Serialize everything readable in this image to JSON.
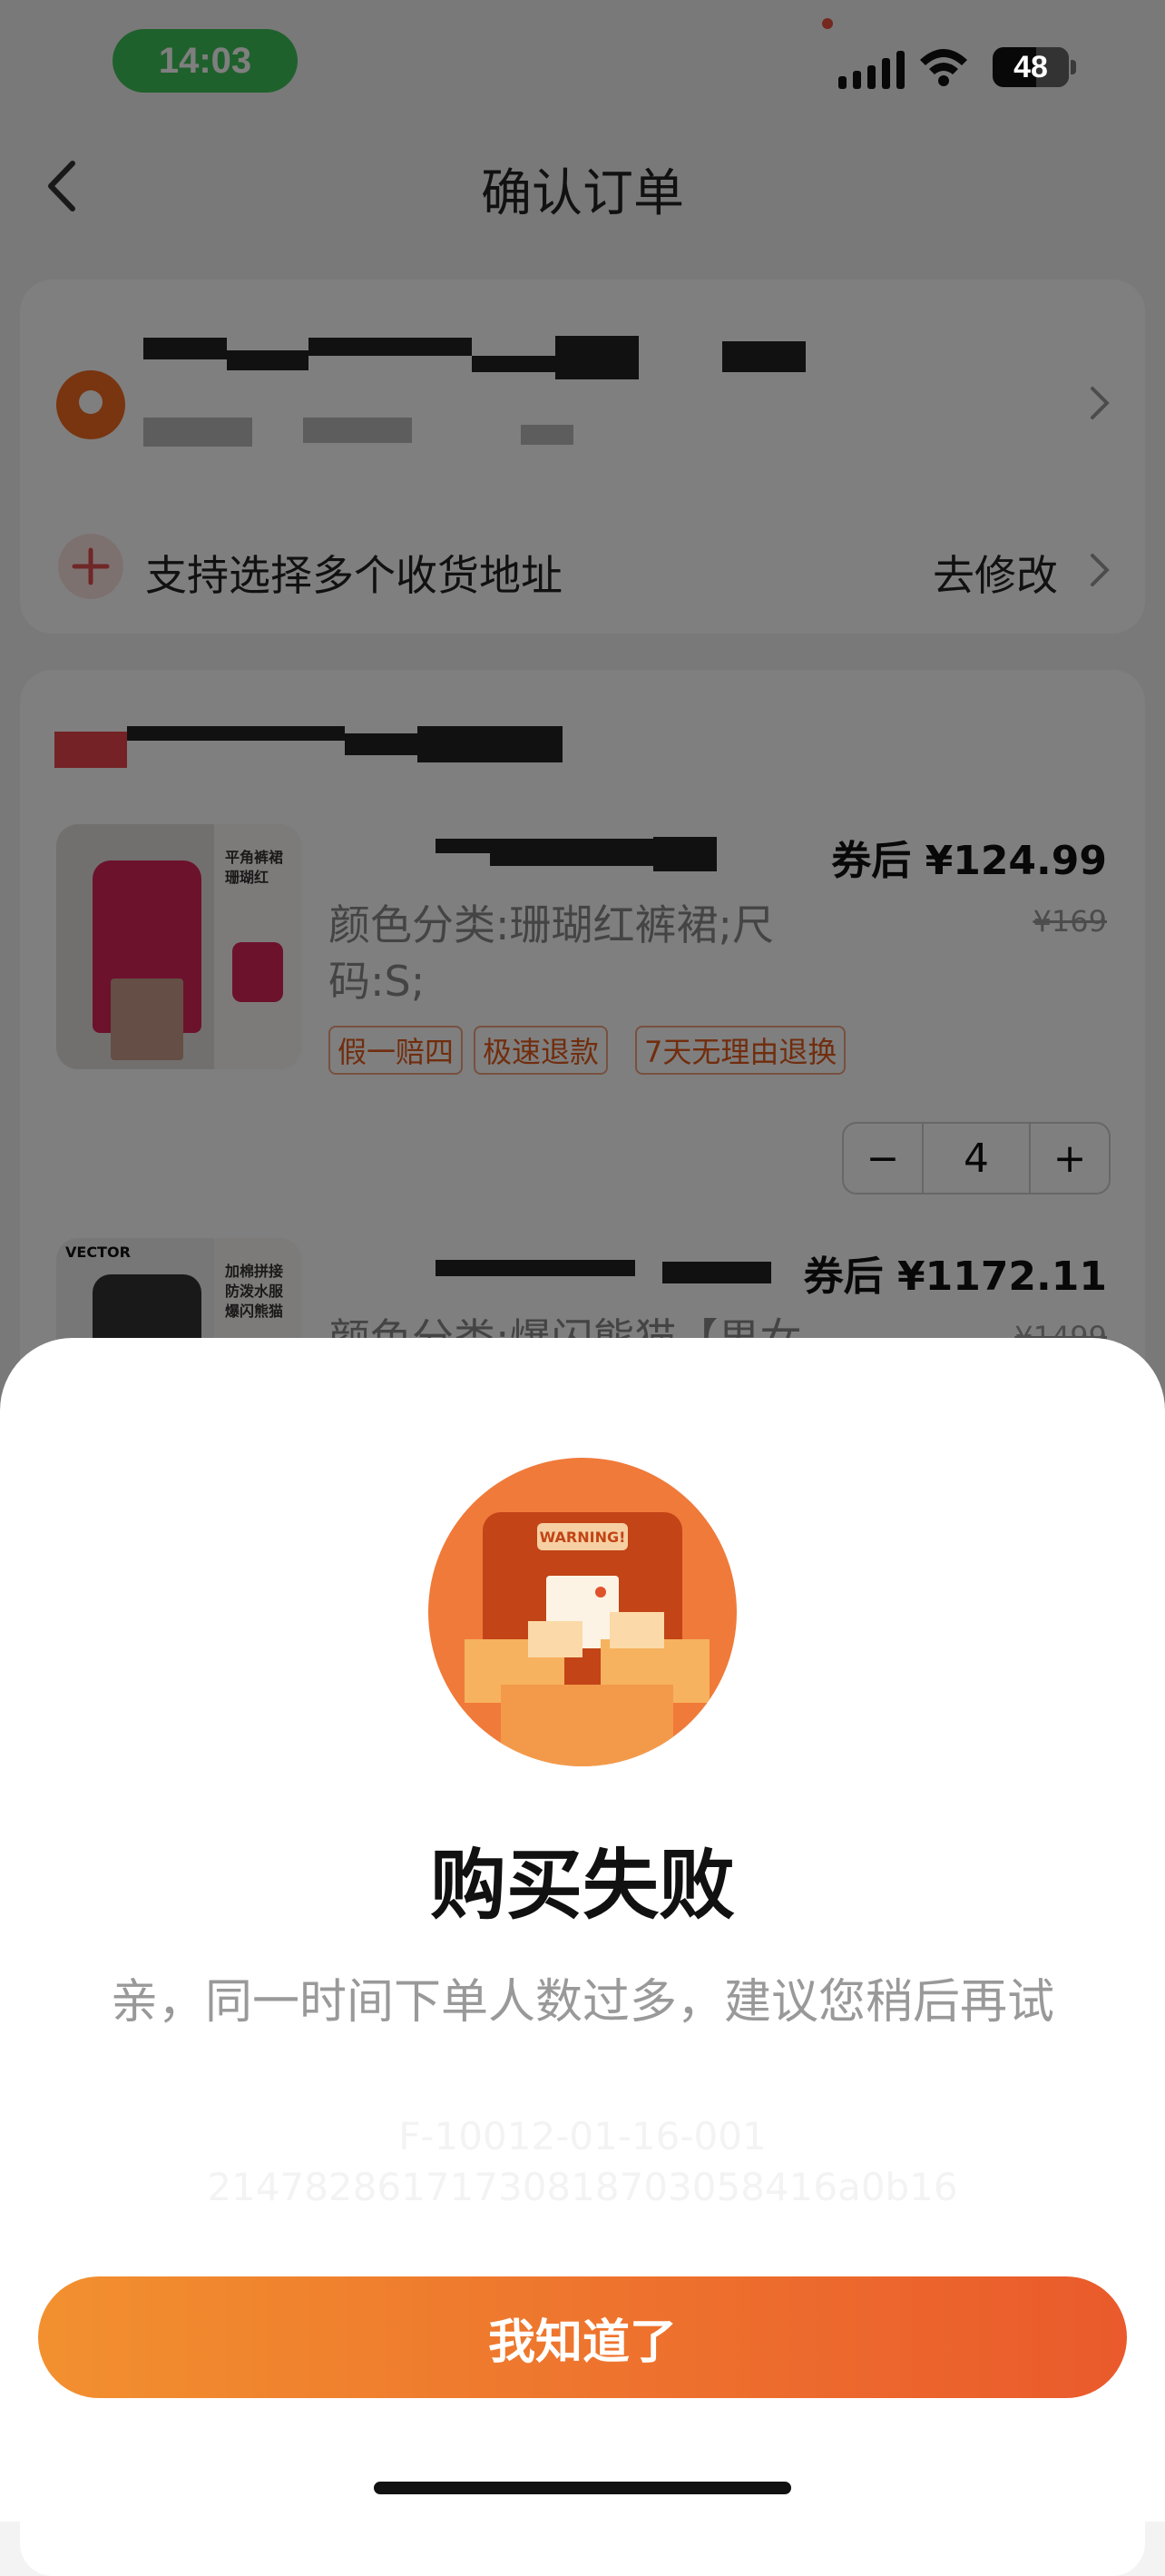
{
  "status_bar": {
    "time": "14:03",
    "battery": "48"
  },
  "nav": {
    "title": "确认订单"
  },
  "address": {
    "multi_address_label": "支持选择多个收货地址",
    "modify_label": "去修改"
  },
  "items": [
    {
      "image_caption_1": "平角裤裙",
      "image_caption_2": "珊瑚红",
      "price": "券后 ¥124.99",
      "original_price": "¥169",
      "spec": "颜色分类:珊瑚红裤裙;尺码:S;",
      "tags": [
        "假一赔四",
        "极速退款",
        "7天无理由退换"
      ],
      "quantity": "4",
      "minus": "−",
      "plus": "+"
    },
    {
      "image_brand": "VECTOR",
      "image_caption_1": "加棉拼接防泼水服",
      "image_caption_2": "爆闪熊猫",
      "price": "券后 ¥1172.11",
      "original_price": "¥1499",
      "spec": "颜色分类:爆闪熊猫【男女"
    }
  ],
  "dialog": {
    "title": "购买失败",
    "message": "亲，同一时间下单人数过多，建议您稍后再试",
    "error_code": "F-10012-01-16-001",
    "trace_id": "21478286171730818703058416a0b16",
    "illustration_text": "WARNING!",
    "button": "我知道了"
  }
}
